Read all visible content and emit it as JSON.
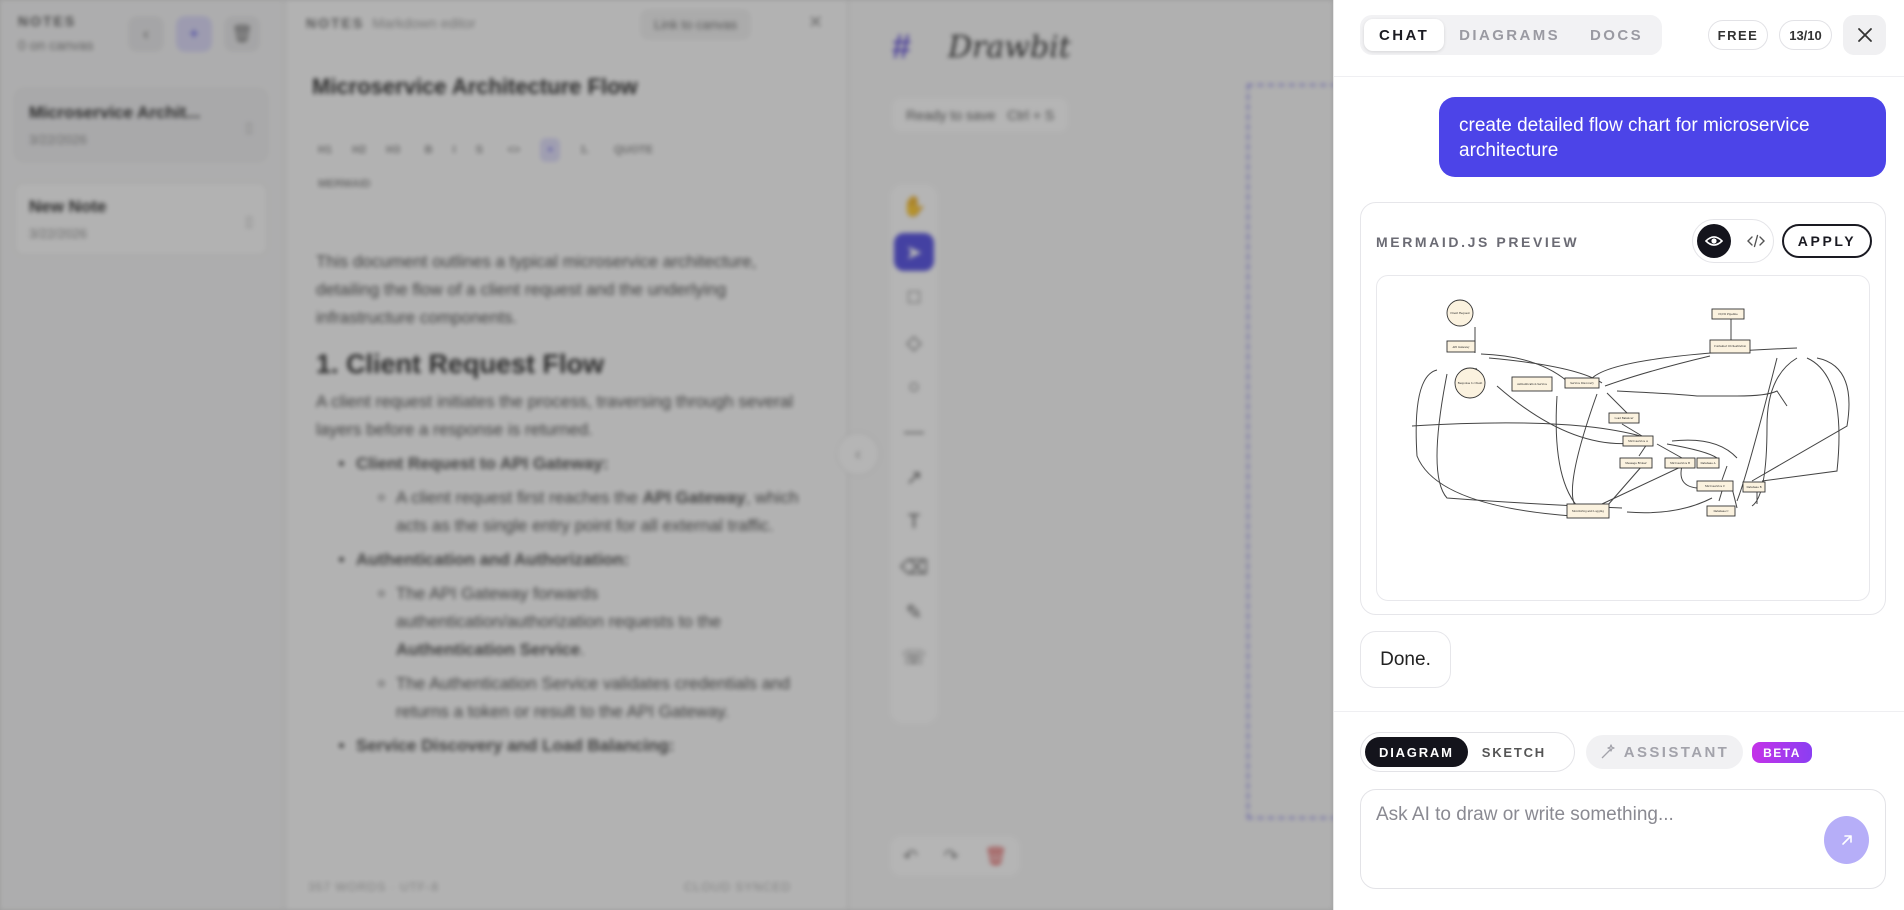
{
  "notes_sidebar": {
    "title": "NOTES",
    "subtitle": "0 on canvas",
    "notes": [
      {
        "title": "Microservice Archit...",
        "date": "3/22/2026"
      },
      {
        "title": "New Note",
        "date": "3/22/2026"
      }
    ]
  },
  "editor": {
    "header": "NOTES",
    "header_sub": "Markdown editor",
    "link_label": "Link to canvas",
    "doc_title": "Microservice Architecture Flow",
    "toolbar": [
      "H1",
      "H2",
      "H3",
      "B",
      "I",
      "S",
      "<>",
      "•",
      "1.",
      "QUOTE",
      "MERMAID"
    ],
    "intro": "This document outlines a typical microservice architecture, detailing the flow of a client request and the underlying infrastructure components.",
    "heading": "1. Client Request Flow",
    "para": "A client request initiates the process, traversing through several layers before a response is returned.",
    "b1": "Client Request to API Gateway:",
    "b1a_pre": "A client request first reaches the ",
    "b1a_bold": "API Gateway",
    "b1a_post": ", which acts as the single entry point for all external traffic.",
    "b2": "Authentication and Authorization:",
    "b2a_pre": "The API Gateway forwards authentication/authorization requests to the ",
    "b2a_bold": "Authentication Service",
    "b2b": "The Authentication Service validates credentials and returns a token or result to the API Gateway.",
    "b3": "Service Discovery and Load Balancing:",
    "footer_left": "357 WORDS · UTF-8",
    "footer_right": "CLOUD SYNCED"
  },
  "canvas": {
    "logo_text": "Drawbit",
    "status": "Ready to save",
    "shortcut": "Ctrl + S",
    "color_hex": "#000"
  },
  "panel": {
    "tabs": [
      "CHAT",
      "DIAGRAMS",
      "DOCS"
    ],
    "active_tab": "CHAT",
    "plan": "FREE",
    "usage": "13/10",
    "user_message": "create detailed flow chart for microservice architecture",
    "preview_label": "MERMAID.JS PREVIEW",
    "apply_label": "APPLY",
    "assistant_reply": "Done.",
    "modes": [
      "DIAGRAM",
      "SKETCH"
    ],
    "active_mode": "DIAGRAM",
    "assistant_label": "ASSISTANT",
    "beta_label": "BETA",
    "input_placeholder": "Ask AI to draw or write something..."
  },
  "mermaid_nodes": [
    "Client Request",
    "API Gateway",
    "Authentication Service",
    "Service Discovery",
    "Load Balancer",
    "Microservice A",
    "Microservice B",
    "Microservice C",
    "Database A",
    "Database B",
    "Database C",
    "Message Broker",
    "Monitoring and Logging",
    "CI/CD Pipeline",
    "Container Orchestration",
    "Response to Client"
  ]
}
